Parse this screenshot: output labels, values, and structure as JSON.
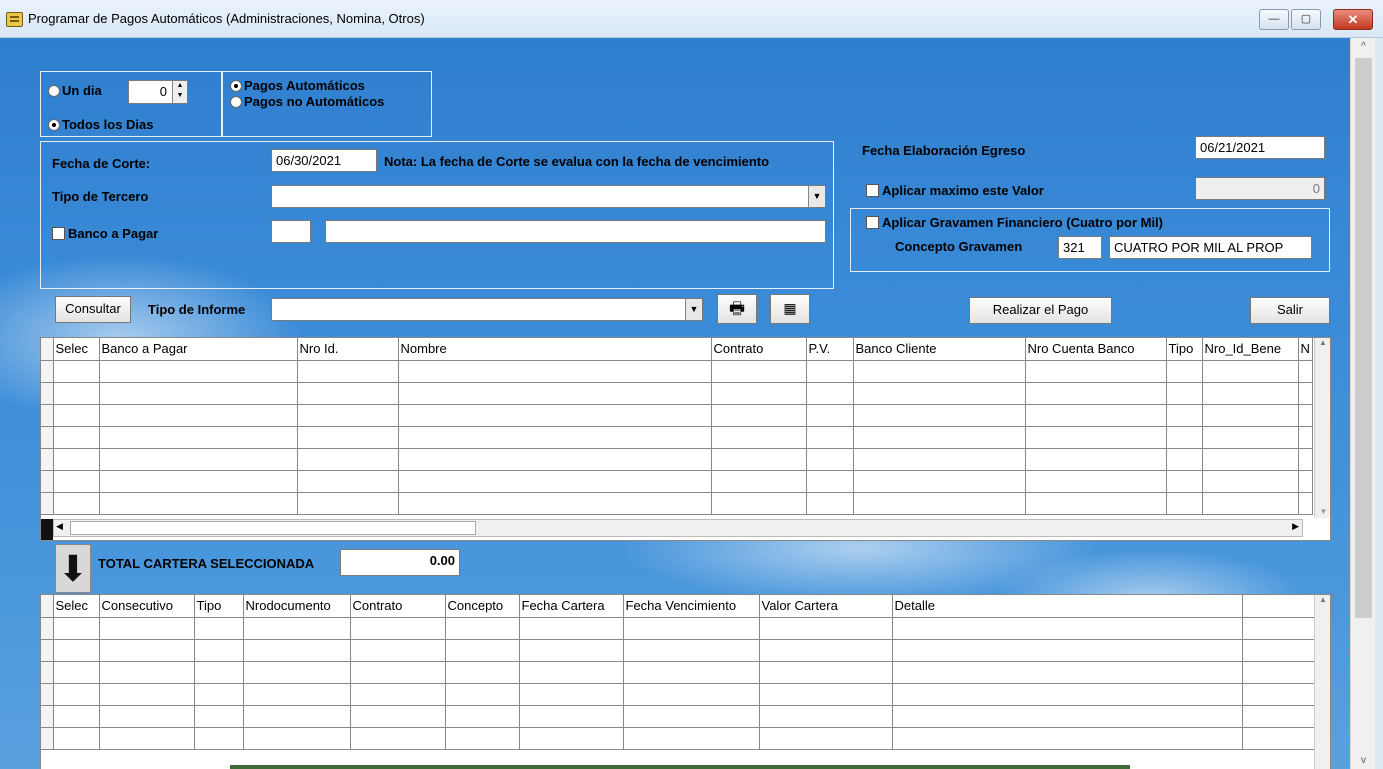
{
  "window": {
    "title": "Programar de Pagos Automáticos (Administraciones, Nomina, Otros)",
    "min_label": "—",
    "max_label": "▢",
    "close_label": "✕"
  },
  "options": {
    "un_dia_label": "Un dia",
    "un_dia_value": "0",
    "todos_los_dias_label": "Todos los Dias",
    "pagos_automaticos_label": "Pagos Automáticos",
    "pagos_no_automaticos_label": "Pagos no Automáticos"
  },
  "filters": {
    "fecha_corte_label": "Fecha de Corte:",
    "fecha_corte_value": "06/30/2021",
    "nota": "Nota: La fecha de Corte se evalua con la fecha de vencimiento",
    "tipo_tercero_label": "Tipo de Tercero",
    "tipo_tercero_value": "",
    "banco_pagar_label": "Banco a Pagar",
    "banco_code": "",
    "banco_name": ""
  },
  "right_panel": {
    "fecha_elaboracion_label": "Fecha Elaboración Egreso",
    "fecha_elaboracion_value": "06/21/2021",
    "aplicar_maximo_label": "Aplicar maximo este Valor",
    "aplicar_maximo_value": "0",
    "aplicar_gravamen_label": "Aplicar Gravamen Financiero (Cuatro por Mil)",
    "concepto_gravamen_label": "Concepto Gravamen",
    "concepto_code": "321",
    "concepto_desc": "CUATRO POR MIL AL PROP"
  },
  "toolbar": {
    "consultar_label": "Consultar",
    "tipo_informe_label": "Tipo de Informe",
    "tipo_informe_value": "",
    "print_icon": "printer-icon",
    "excel_icon": "excel-export-icon",
    "realizar_pago_label": "Realizar el Pago",
    "salir_label": "Salir"
  },
  "grid_top": {
    "columns": [
      "Selec",
      "Banco a Pagar",
      "Nro Id.",
      "Nombre",
      "Contrato",
      "P.V.",
      "Banco Cliente",
      "Nro Cuenta Banco",
      "Tipo",
      "Nro_Id_Bene",
      "N"
    ]
  },
  "totals": {
    "label": "TOTAL CARTERA SELECCIONADA",
    "value": "0.00"
  },
  "grid_bottom": {
    "columns": [
      "Selec",
      "Consecutivo",
      "Tipo",
      "Nrodocumento",
      "Contrato",
      "Concepto",
      "Fecha Cartera",
      "Fecha Vencimiento",
      "Valor Cartera",
      "Detalle",
      ""
    ]
  }
}
